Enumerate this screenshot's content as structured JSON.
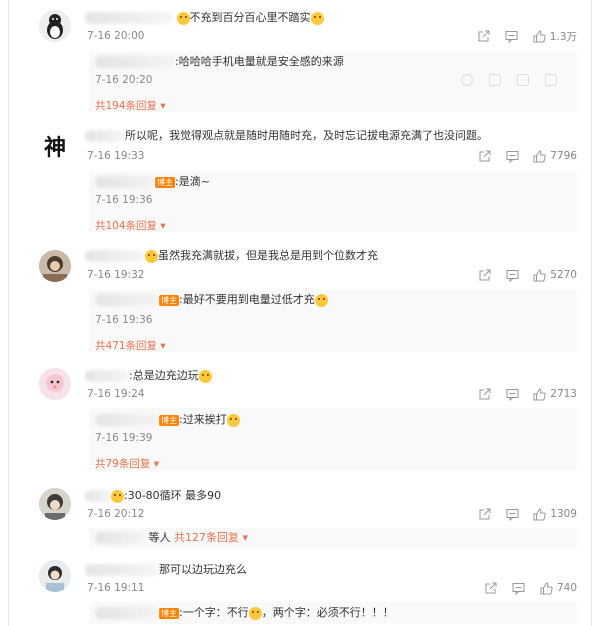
{
  "comments": [
    {
      "text": "不充到百分百心里不踏实",
      "time": "7-16 20:00",
      "likes": "1.3万",
      "reply": {
        "text": ":哈哈哈手机电量就是安全感的来源",
        "time": "7-16 20:20"
      },
      "more_replies": "共194条回复"
    },
    {
      "avatar_text": "神",
      "text": "所以呢，我觉得观点就是随时用随时充，及时忘记拔电源充满了也没问题。",
      "time": "7-16 19:33",
      "likes": "7796",
      "reply": {
        "badge": "博主",
        "text": ":是滴~",
        "time": "7-16 19:36"
      },
      "more_replies": "共104条回复"
    },
    {
      "text": "虽然我充满就拔，但是我总是用到个位数才充",
      "time": "7-16 19:32",
      "likes": "5270",
      "reply": {
        "badge": "博主",
        "text": ":最好不要用到电量过低才充",
        "time": "7-16 19:36"
      },
      "more_replies": "共471条回复"
    },
    {
      "text": ":总是边充边玩",
      "time": "7-16 19:24",
      "likes": "2713",
      "reply": {
        "badge": "博主",
        "text": ":过来挨打",
        "time": "7-16 19:39"
      },
      "more_replies": "共79条回复"
    },
    {
      "text": ":30-80循环 最多90",
      "time": "7-16 20:12",
      "likes": "1309",
      "reply_summary_prefix": "等人",
      "more_replies": "共127条回复"
    },
    {
      "text": "那可以边玩边充么",
      "time": "7-16 19:11",
      "likes": "740",
      "reply": {
        "badge": "博主",
        "text": ":一个字：不行",
        "text2": "，两个字：必须不行！！！"
      }
    }
  ],
  "icons": {
    "share": "share-icon",
    "comment": "comment-icon",
    "like": "thumbs-up-icon",
    "emoji": "emoji-icon"
  },
  "colors": {
    "link": "#eb7350",
    "badge": "#ff8200",
    "muted": "#888888"
  }
}
